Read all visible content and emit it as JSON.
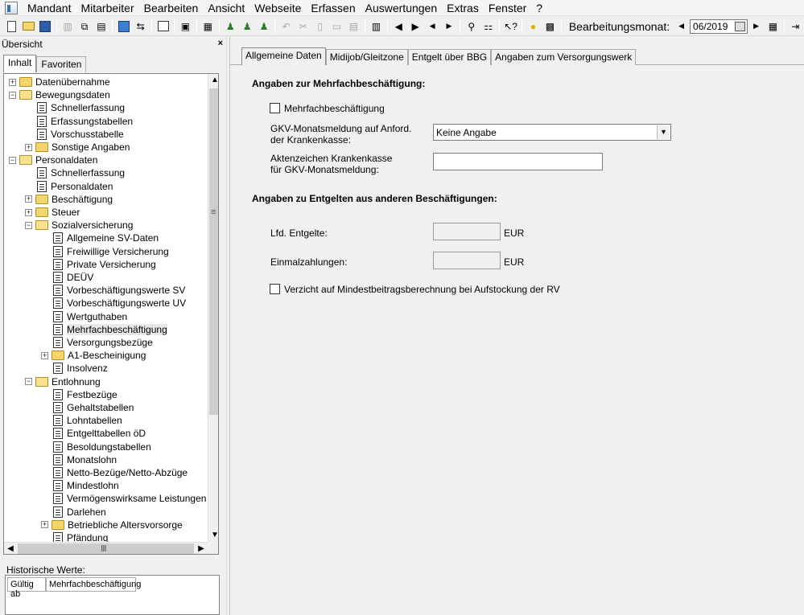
{
  "menu": [
    "Mandant",
    "Mitarbeiter",
    "Bearbeiten",
    "Ansicht",
    "Webseite",
    "Erfassen",
    "Auswertungen",
    "Extras",
    "Fenster",
    "?"
  ],
  "toolbar": {
    "month_label": "Bearbeitungsmonat:",
    "month_value": "06/2019"
  },
  "left": {
    "header": "Übersicht",
    "close": "×",
    "tabs": [
      "Inhalt",
      "Favoriten"
    ],
    "tree": [
      {
        "label": "Datenübernahme",
        "type": "folder",
        "expander": "+",
        "level": 0
      },
      {
        "label": "Bewegungsdaten",
        "type": "folder",
        "expander": "−",
        "level": 0,
        "open": true
      },
      {
        "label": "Schnellerfassung",
        "type": "doc",
        "level": 1
      },
      {
        "label": "Erfassungstabellen",
        "type": "doc",
        "level": 1
      },
      {
        "label": "Vorschusstabelle",
        "type": "doc",
        "level": 1
      },
      {
        "label": "Sonstige Angaben",
        "type": "folder",
        "expander": "+",
        "level": 1
      },
      {
        "label": "Personaldaten",
        "type": "folder",
        "expander": "−",
        "level": 0,
        "open": true
      },
      {
        "label": "Schnellerfassung",
        "type": "doc",
        "level": 1
      },
      {
        "label": "Personaldaten",
        "type": "doc",
        "level": 1
      },
      {
        "label": "Beschäftigung",
        "type": "folder",
        "expander": "+",
        "level": 1
      },
      {
        "label": "Steuer",
        "type": "folder",
        "expander": "+",
        "level": 1
      },
      {
        "label": "Sozialversicherung",
        "type": "folder",
        "expander": "−",
        "level": 1,
        "open": true
      },
      {
        "label": "Allgemeine SV-Daten",
        "type": "doc",
        "level": 2
      },
      {
        "label": "Freiwillige Versicherung",
        "type": "doc",
        "level": 2
      },
      {
        "label": "Private Versicherung",
        "type": "doc",
        "level": 2
      },
      {
        "label": "DEÜV",
        "type": "doc",
        "level": 2
      },
      {
        "label": "Vorbeschäftigungswerte SV",
        "type": "doc",
        "level": 2
      },
      {
        "label": "Vorbeschäftigungswerte UV",
        "type": "doc",
        "level": 2
      },
      {
        "label": "Wertguthaben",
        "type": "doc",
        "level": 2
      },
      {
        "label": "Mehrfachbeschäftigung",
        "type": "doc",
        "level": 2,
        "selected": true
      },
      {
        "label": "Versorgungsbezüge",
        "type": "doc",
        "level": 2
      },
      {
        "label": "A1-Bescheinigung",
        "type": "folder",
        "expander": "+",
        "level": 2
      },
      {
        "label": "Insolvenz",
        "type": "doc",
        "level": 2
      },
      {
        "label": "Entlohnung",
        "type": "folder",
        "expander": "−",
        "level": 1,
        "open": true
      },
      {
        "label": "Festbezüge",
        "type": "doc",
        "level": 2
      },
      {
        "label": "Gehaltstabellen",
        "type": "doc",
        "level": 2
      },
      {
        "label": "Lohntabellen",
        "type": "doc",
        "level": 2
      },
      {
        "label": "Entgelttabellen öD",
        "type": "doc",
        "level": 2
      },
      {
        "label": "Besoldungstabellen",
        "type": "doc",
        "level": 2
      },
      {
        "label": "Monatslohn",
        "type": "doc",
        "level": 2
      },
      {
        "label": "Netto-Bezüge/Netto-Abzüge",
        "type": "doc",
        "level": 2
      },
      {
        "label": "Mindestlohn",
        "type": "doc",
        "level": 2
      },
      {
        "label": "Vermögenswirksame Leistungen",
        "type": "doc",
        "level": 2
      },
      {
        "label": "Darlehen",
        "type": "doc",
        "level": 2
      },
      {
        "label": "Betriebliche Altersvorsorge",
        "type": "folder",
        "expander": "+",
        "level": 2
      },
      {
        "label": "Pfändung",
        "type": "doc",
        "level": 2
      }
    ],
    "hist_label": "Historische Werte:",
    "hist_cols": [
      "Gültig ab",
      "Mehrfachbeschäftigung"
    ]
  },
  "right": {
    "tabs": [
      "Allgemeine Daten",
      "Midijob/Gleitzone",
      "Entgelt über BBG",
      "Angaben zum Versorgungswerk"
    ],
    "section1": "Angaben zur Mehrfachbeschäftigung:",
    "chk_mehrfach": "Mehrfachbeschäftigung",
    "gkv_label1": "GKV-Monatsmeldung auf Anford.",
    "gkv_label2": "der Krankenkasse:",
    "gkv_value": "Keine Angabe",
    "akt_label1": "Aktenzeichen Krankenkasse",
    "akt_label2": "für GKV-Monatsmeldung:",
    "akt_value": "",
    "section2": "Angaben zu Entgelten aus anderen Beschäftigungen:",
    "lfd_label": "Lfd. Entgelte:",
    "lfd_value": "",
    "einmal_label": "Einmalzahlungen:",
    "einmal_value": "",
    "currency": "EUR",
    "chk_verzicht": "Verzicht auf Mindestbeitragsberechnung bei Aufstockung der RV"
  }
}
